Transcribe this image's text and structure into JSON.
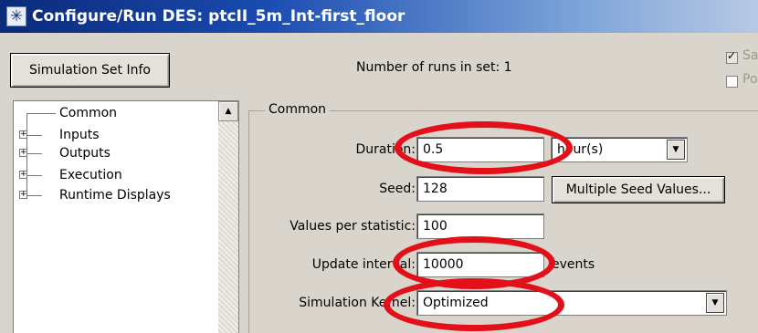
{
  "window": {
    "title": "Configure/Run DES: ptcII_5m_Int-first_floor"
  },
  "top": {
    "sim_set_info_label": "Simulation Set Info",
    "runs_label": "Number of runs in set: 1",
    "checkbox_1": {
      "label": "Sa",
      "checked": true
    },
    "checkbox_2": {
      "label": "Po",
      "checked": false
    }
  },
  "tree": {
    "items": [
      {
        "label": "Common",
        "expandable": false
      },
      {
        "label": "Inputs",
        "expandable": true
      },
      {
        "label": "Outputs",
        "expandable": true
      },
      {
        "label": "Execution",
        "expandable": true
      },
      {
        "label": "Runtime Displays",
        "expandable": true
      }
    ]
  },
  "common": {
    "legend": "Common",
    "duration": {
      "label": "Duration:",
      "value": "0.5",
      "unit": "hour(s)"
    },
    "seed": {
      "label": "Seed:",
      "value": "128",
      "multi_button": "Multiple Seed Values..."
    },
    "values_per_statistic": {
      "label": "Values per statistic:",
      "value": "100"
    },
    "update_interval": {
      "label": "Update interval:",
      "value": "10000",
      "unit": "events"
    },
    "simulation_kernel": {
      "label": "Simulation Kernel:",
      "value": "Optimized"
    }
  },
  "colors": {
    "annotation": "#e3101a",
    "titlebar": "#0a2a7a"
  },
  "icons": {
    "app": "asterisk-icon",
    "dropdown": "chevron-down-icon",
    "scroll": "scroll-up-arrow-icon"
  }
}
